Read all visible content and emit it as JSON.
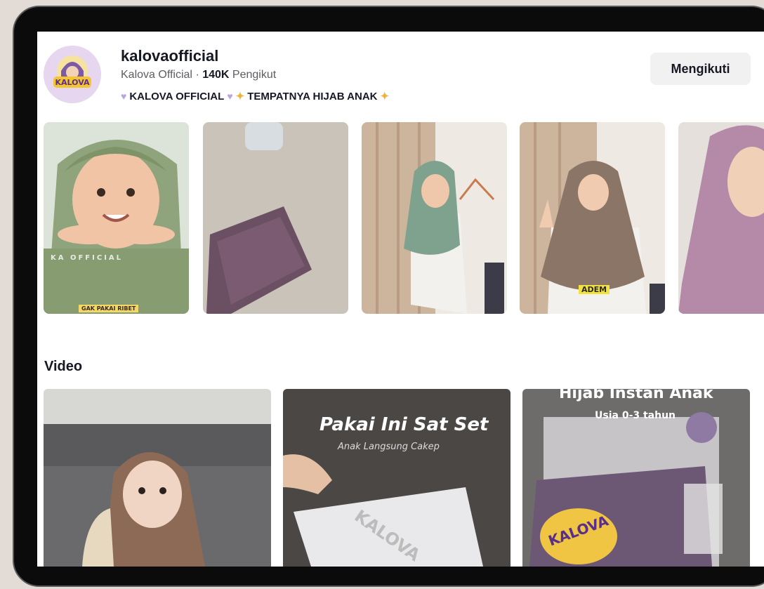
{
  "profile": {
    "username": "kalovaofficial",
    "display_name": "Kalova Official",
    "separator": "·",
    "followers_count": "140K",
    "followers_label": "Pengikut",
    "bio_text1": "KALOVA OFFICIAL",
    "bio_text2": "TEMPATNYA HIJAB ANAK",
    "avatar_logo_text": "KALOVA",
    "follow_button": "Mengikuti"
  },
  "photos": [
    {
      "caption": "KA OFFICIAL",
      "badge": "GAK PAKAI RIBET"
    },
    {
      "caption": ""
    },
    {
      "caption": ""
    },
    {
      "badge": "ADEM"
    },
    {
      "caption": ""
    }
  ],
  "video_section": {
    "title": "Video",
    "items": [
      {
        "overlay_title": "",
        "overlay_sub": ""
      },
      {
        "overlay_title": "Pakai Ini Sat Set",
        "overlay_sub": "Anak Langsung Cakep",
        "package_text": "KALOVA"
      },
      {
        "overlay_title": "Hijab Instan Anak",
        "overlay_sub": "Usia 0-3 tahun",
        "package_text": "KALOVA"
      }
    ]
  },
  "icons": {
    "heart": "purple-heart-icon",
    "sparkle": "sparkle-icon"
  },
  "colors": {
    "follow_bg": "#f1f1f2",
    "text": "#161823",
    "muted": "#5c5d62"
  }
}
